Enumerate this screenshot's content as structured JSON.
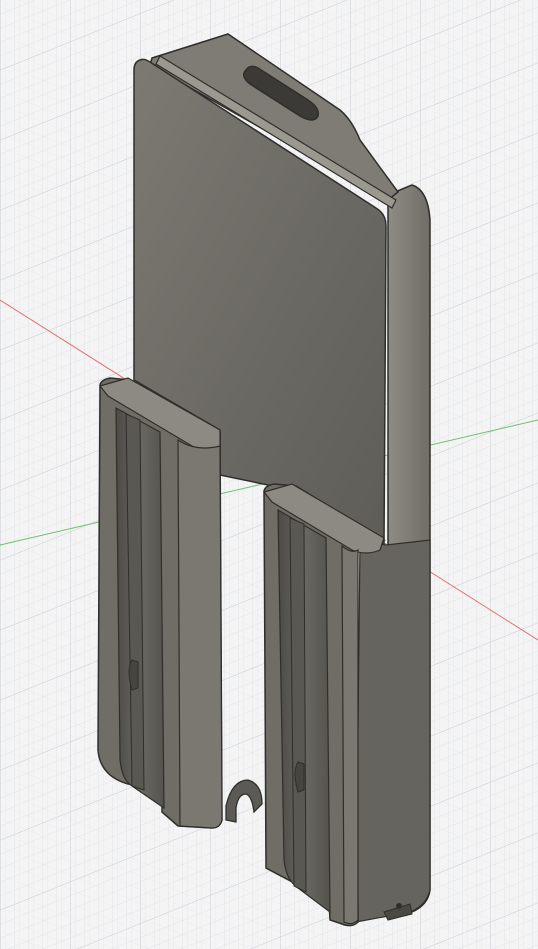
{
  "viewport": {
    "background_color": "#f4f4f5",
    "grid_line_color": "#c9cdd3",
    "grid_minor_color": "#dde0e4",
    "axis_x_color": "#e07070",
    "axis_y_color": "#6fbf6f"
  },
  "model": {
    "body_color": "#6e6c66",
    "face_light": "#8a8880",
    "face_dark": "#55534e",
    "edge_color": "#2f2e2b",
    "highlight": "#a3a199"
  }
}
